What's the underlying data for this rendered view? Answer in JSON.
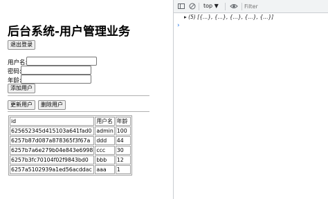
{
  "page": {
    "title": "后台系统-用户管理业务",
    "logout_label": "退出登录",
    "form": {
      "username_label": "用户名:",
      "password_label": "密码:",
      "age_label": "年龄:",
      "username_value": "",
      "password_value": "",
      "age_value": "",
      "add_label": "添加用户"
    },
    "update_label": "更新用户",
    "delete_label": "删除用户",
    "table": {
      "headers": [
        "id",
        "用户名",
        "年龄"
      ],
      "rows": [
        [
          "625652345d415103a641fad0",
          "admin",
          "100"
        ],
        [
          "6257b87d087a878365f3f67a",
          "ddd",
          "44"
        ],
        [
          "6257b7a6e279b04e843e6998",
          "ccc",
          "30"
        ],
        [
          "6257b3fc70104f02f9843bd0",
          "bbb",
          "12"
        ],
        [
          "6257a5102939a1ed56acddac",
          "aaa",
          "1"
        ]
      ]
    }
  },
  "devtools": {
    "context": "top ▼",
    "filter_placeholder": "Filter",
    "log": "▸ (5) [{…}, {…}, {…}, {…}, {…}]",
    "prompt": "›",
    "icons": [
      "sidebar-icon",
      "clear-console-icon",
      "eye-icon"
    ]
  }
}
